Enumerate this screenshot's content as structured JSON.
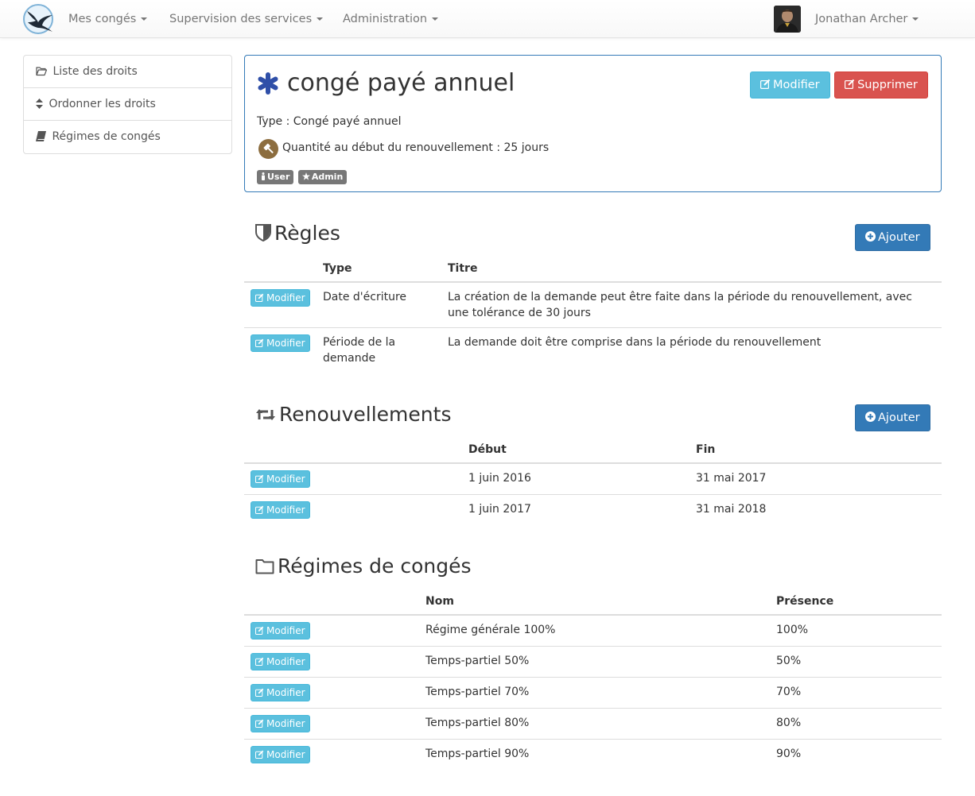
{
  "navbar": {
    "menus": [
      "Mes congés",
      "Supervision des services",
      "Administration"
    ],
    "user_name": "Jonathan Archer"
  },
  "sidebar": {
    "items": [
      {
        "label": "Liste des droits",
        "icon": "folder-open-icon"
      },
      {
        "label": "Ordonner les droits",
        "icon": "sort-icon"
      },
      {
        "label": "Régimes de congés",
        "icon": "book-icon"
      }
    ]
  },
  "right": {
    "title": "congé payé annuel",
    "icon": "asterisk-icon",
    "icon_color": "#2f4fa8",
    "edit_label": "Modifier",
    "delete_label": "Supprimer",
    "type_text": "Type : Congé payé annuel",
    "quantity_text": "Quantité au début du renouvellement : 25 jours",
    "badges": [
      "User",
      "Admin"
    ]
  },
  "rules": {
    "title": "Règles",
    "add_label": "Ajouter",
    "columns": [
      "Type",
      "Titre"
    ],
    "rows": [
      {
        "action": "Modifier",
        "type": "Date d'écriture",
        "title": "La création de la demande peut être faite dans la période du renouvellement, avec une tolérance de 30 jours"
      },
      {
        "action": "Modifier",
        "type": "Période de la demande",
        "title": "La demande doit être comprise dans la période du renouvellement"
      }
    ]
  },
  "renewals": {
    "title": "Renouvellements",
    "add_label": "Ajouter",
    "columns": [
      "Début",
      "Fin"
    ],
    "rows": [
      {
        "action": "Modifier",
        "start": "1 juin 2016",
        "end": "31 mai 2017"
      },
      {
        "action": "Modifier",
        "start": "1 juin 2017",
        "end": "31 mai 2018"
      }
    ]
  },
  "regimes": {
    "title": "Régimes de congés",
    "columns": [
      "Nom",
      "Présence"
    ],
    "rows": [
      {
        "action": "Modifier",
        "name": "Régime générale 100%",
        "presence": "100%"
      },
      {
        "action": "Modifier",
        "name": "Temps-partiel 50%",
        "presence": "50%"
      },
      {
        "action": "Modifier",
        "name": "Temps-partiel 70%",
        "presence": "70%"
      },
      {
        "action": "Modifier",
        "name": "Temps-partiel 80%",
        "presence": "80%"
      },
      {
        "action": "Modifier",
        "name": "Temps-partiel 90%",
        "presence": "90%"
      }
    ]
  },
  "colors": {
    "info": "#5bc0de",
    "danger": "#d9534f",
    "primary": "#337ab7",
    "badge": "#777777"
  }
}
